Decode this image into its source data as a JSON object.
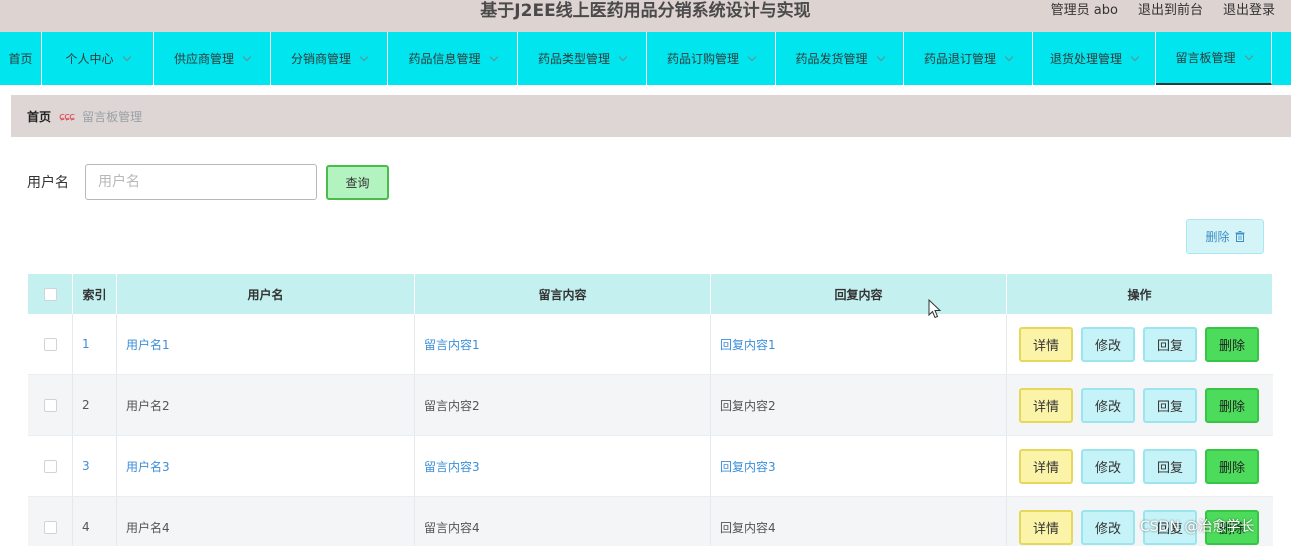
{
  "header": {
    "title": "基于J2EE线上医药用品分销系统设计与实现",
    "admin_label": "管理员 abo",
    "to_front_label": "退出到前台",
    "logout_label": "退出登录"
  },
  "nav": {
    "items": [
      {
        "label": "首页"
      },
      {
        "label": "个人中心"
      },
      {
        "label": "供应商管理"
      },
      {
        "label": "分销商管理"
      },
      {
        "label": "药品信息管理"
      },
      {
        "label": "药品类型管理"
      },
      {
        "label": "药品订购管理"
      },
      {
        "label": "药品发货管理"
      },
      {
        "label": "药品退订管理"
      },
      {
        "label": "退货处理管理"
      },
      {
        "label": "留言板管理"
      }
    ],
    "active": "留言板管理"
  },
  "breadcrumb": {
    "home": "首页",
    "separator": "ɕɕɕ",
    "current": "留言板管理"
  },
  "search": {
    "label": "用户名",
    "placeholder": "用户名",
    "value": "",
    "button_label": "查询"
  },
  "toolbar": {
    "delete_label": "删除"
  },
  "table": {
    "headers": {
      "index": "索引",
      "username": "用户名",
      "message": "留言内容",
      "reply": "回复内容",
      "ops": "操作"
    },
    "rows": [
      {
        "index": "1",
        "username": "用户名1",
        "message": "留言内容1",
        "reply": "回复内容1"
      },
      {
        "index": "2",
        "username": "用户名2",
        "message": "留言内容2",
        "reply": "回复内容2"
      },
      {
        "index": "3",
        "username": "用户名3",
        "message": "留言内容3",
        "reply": "回复内容3"
      },
      {
        "index": "4",
        "username": "用户名4",
        "message": "留言内容4",
        "reply": "回复内容4"
      }
    ],
    "ops": {
      "detail": "详情",
      "edit": "修改",
      "reply": "回复",
      "delete": "删除"
    }
  },
  "watermark": "CSDN @治愈学长",
  "colors": {
    "header_bg": "#ddd3d1",
    "nav_bg": "#00e5ee",
    "table_header_bg": "#c4f0f0",
    "link": "#3b8fd8"
  }
}
